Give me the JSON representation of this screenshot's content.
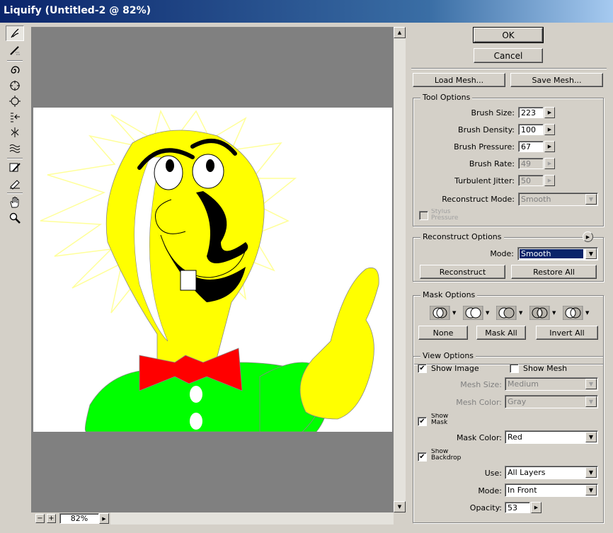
{
  "window": {
    "title": "Liquify (Untitled-2 @ 82%)"
  },
  "zoom": {
    "minus": "−",
    "plus": "+",
    "value": "82%"
  },
  "buttons": {
    "ok": "OK",
    "cancel": "Cancel",
    "load_mesh": "Load Mesh...",
    "save_mesh": "Save Mesh..."
  },
  "tool_options": {
    "title": "Tool Options",
    "brush_size": {
      "label": "Brush Size:",
      "value": "223"
    },
    "brush_density": {
      "label": "Brush Density:",
      "value": "100"
    },
    "brush_pressure": {
      "label": "Brush Pressure:",
      "value": "67"
    },
    "brush_rate": {
      "label": "Brush Rate:",
      "value": "49"
    },
    "turbulent_jitter": {
      "label": "Turbulent Jitter:",
      "value": "50"
    },
    "reconstruct_mode": {
      "label": "Reconstruct Mode:",
      "value": "Smooth"
    },
    "stylus_pressure": "Stylus Pressure"
  },
  "reconstruct_options": {
    "title": "Reconstruct Options",
    "mode_label": "Mode:",
    "mode_value": "Smooth",
    "reconstruct": "Reconstruct",
    "restore_all": "Restore All"
  },
  "mask_options": {
    "title": "Mask Options",
    "none": "None",
    "mask_all": "Mask All",
    "invert_all": "Invert All"
  },
  "view_options": {
    "title": "View Options",
    "show_image": "Show Image",
    "show_mesh": "Show Mesh",
    "mesh_size_label": "Mesh Size:",
    "mesh_size_value": "Medium",
    "mesh_color_label": "Mesh Color:",
    "mesh_color_value": "Gray",
    "show_mask": "Show Mask",
    "mask_color_label": "Mask Color:",
    "mask_color_value": "Red",
    "show_backdrop": "Show Backdrop",
    "use_label": "Use:",
    "use_value": "All Layers",
    "mode_label": "Mode:",
    "mode_value": "In Front",
    "opacity_label": "Opacity:",
    "opacity_value": "53"
  },
  "icons": [
    "forward-warp-icon",
    "reconstruct-tool-icon",
    "twirl-clockwise-icon",
    "pucker-icon",
    "bloat-icon",
    "push-left-icon",
    "mirror-icon",
    "turbulence-icon",
    "freeze-mask-icon",
    "thaw-mask-icon",
    "hand-icon",
    "zoom-icon"
  ],
  "colors": {
    "title_start": "#0a246a",
    "title_end": "#a6caf0",
    "selection": "#0a246a",
    "bulb": "#ffff00",
    "body": "#00ff00",
    "bowtie": "#ff0000"
  }
}
